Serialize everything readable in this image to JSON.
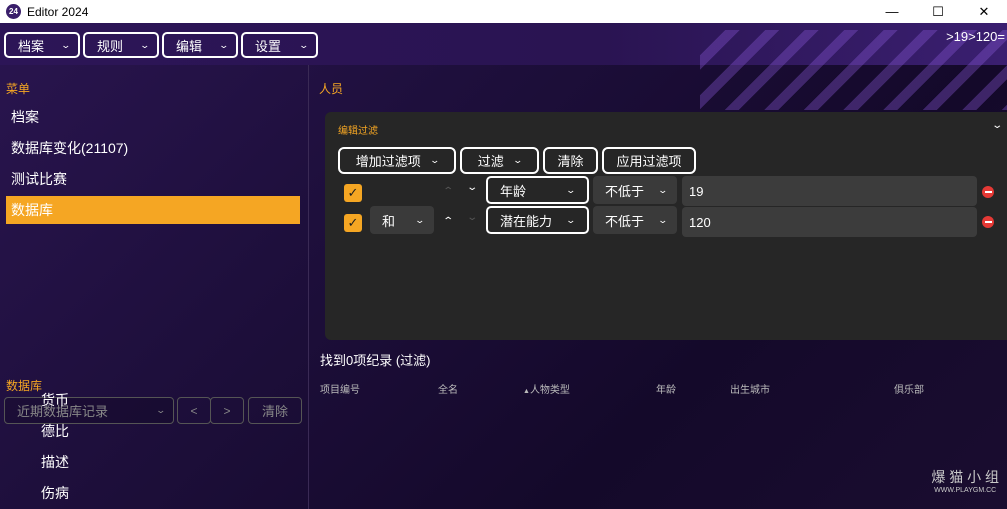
{
  "window": {
    "title": "Editor 2024",
    "icon_text": "24",
    "minimize": "—",
    "maximize": "☐",
    "close": "✕"
  },
  "menubar": {
    "items": [
      {
        "label": "档案"
      },
      {
        "label": "规则"
      },
      {
        "label": "编辑"
      },
      {
        "label": "设置"
      }
    ]
  },
  "breadcrumb": ">19>120=",
  "sidebar": {
    "menu_title": "菜单",
    "items": [
      {
        "label": "档案"
      },
      {
        "label": "数据库变化(21107)"
      },
      {
        "label": "测试比赛"
      },
      {
        "label": "数据库",
        "active": true
      }
    ],
    "recent": {
      "label": "近期数据库记录",
      "prev": "<",
      "next": ">",
      "clear": "清除"
    },
    "db_title": "数据库",
    "db_items": [
      {
        "label": "货币"
      },
      {
        "label": "德比"
      },
      {
        "label": "描述"
      },
      {
        "label": "伤病"
      }
    ]
  },
  "main": {
    "section_title": "人员",
    "filter_panel": {
      "title": "编辑过滤",
      "buttons": {
        "add": "增加过滤项",
        "filter": "过滤",
        "clear": "清除",
        "apply": "应用过滤项"
      },
      "rows": [
        {
          "checked": true,
          "logic": "",
          "field": "年龄",
          "op": "不低于",
          "value": "19"
        },
        {
          "checked": true,
          "logic": "和",
          "field": "潜在能力",
          "op": "不低于",
          "value": "120"
        }
      ]
    },
    "found": "找到0项纪录 (过滤)",
    "columns": [
      "项目编号",
      "全名",
      "人物类型",
      "年龄",
      "出生城市",
      "俱乐部"
    ],
    "sort_indicator": "▲"
  },
  "watermark": {
    "text": "爆 猫 小 组",
    "url": "WWW.PLAYGM.CC"
  },
  "colors": {
    "accent": "#f5a623",
    "remove": "#e53935",
    "panel": "#262626"
  }
}
